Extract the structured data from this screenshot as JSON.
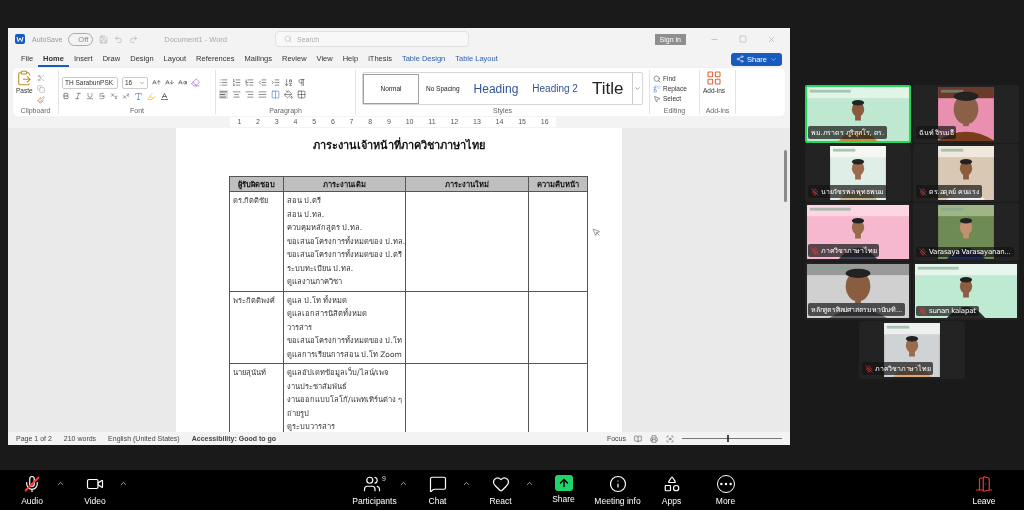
{
  "word": {
    "title_bar": {
      "autosave_label": "AutoSave",
      "autosave_state": "Off",
      "autosave_on": false,
      "document_title": "Document1 - Word",
      "search_placeholder": "Search",
      "sign_in": "Sign in"
    },
    "menu_tabs": [
      {
        "label": "File",
        "selected": false,
        "kind": "normal"
      },
      {
        "label": "Home",
        "selected": true,
        "kind": "normal"
      },
      {
        "label": "Insert",
        "selected": false,
        "kind": "normal"
      },
      {
        "label": "Draw",
        "selected": false,
        "kind": "normal"
      },
      {
        "label": "Design",
        "selected": false,
        "kind": "normal"
      },
      {
        "label": "Layout",
        "selected": false,
        "kind": "normal"
      },
      {
        "label": "References",
        "selected": false,
        "kind": "normal"
      },
      {
        "label": "Mailings",
        "selected": false,
        "kind": "normal"
      },
      {
        "label": "Review",
        "selected": false,
        "kind": "normal"
      },
      {
        "label": "View",
        "selected": false,
        "kind": "normal"
      },
      {
        "label": "Help",
        "selected": false,
        "kind": "normal"
      },
      {
        "label": "iThesis",
        "selected": false,
        "kind": "normal"
      },
      {
        "label": "Table Design",
        "selected": false,
        "kind": "contextual"
      },
      {
        "label": "Table Layout",
        "selected": false,
        "kind": "contextual"
      }
    ],
    "share": "Share",
    "ribbon": {
      "paste": "Paste",
      "font_name": "TH SarabunPSK",
      "font_size": "16",
      "styles": [
        {
          "label": "Normal",
          "kind": "normal",
          "selected": true
        },
        {
          "label": "No Spacing",
          "kind": "nospacing",
          "selected": false
        },
        {
          "label": "Heading",
          "kind": "heading1",
          "selected": false
        },
        {
          "label": "Heading 2",
          "kind": "heading2",
          "selected": false
        },
        {
          "label": "Title",
          "kind": "title",
          "selected": false
        }
      ],
      "editing": [
        "Find",
        "Replace",
        "Select"
      ],
      "addins": "Add-ins",
      "groups": [
        "Clipboard",
        "Font",
        "Paragraph",
        "Styles",
        "Editing",
        "Add-ins"
      ]
    },
    "ruler_numbers": [
      "1",
      "2",
      "3",
      "4",
      "5",
      "6",
      "7",
      "8",
      "9",
      "10",
      "11",
      "12",
      "13",
      "14",
      "15",
      "16"
    ],
    "document": {
      "title": "ภาระงานเจ้าหน้าที่ภาควิชาภาษาไทย",
      "columns": [
        "ผู้รับผิดชอบ",
        "ภาระงานเดิม",
        "ภาระงานใหม่",
        "ความคืบหน้า"
      ],
      "rows": [
        {
          "owner": "ดร.กิตติชัย",
          "tasks": [
            "สอน ป.ตรี",
            "สอน ป.ทล.",
            "ควบคุมหลักสูตร ป.ทล.",
            "ขอเสนอโครงการทั้งหมดของ ป.ทล.",
            "ขอเสนอโครงการทั้งหมดของ ป.ตรี",
            "ระบบทะเบียน ป.ทล.",
            "ดูแลงานภาควิชา"
          ]
        },
        {
          "owner": "พระกิตติพงศ์",
          "tasks": [
            "ดูแล ป.โท ทั้งหมด",
            "ดูแลเอกสารนิสิตทั้งหมด",
            "วารสาร",
            "ขอเสนอโครงการทั้งหมดของ ป.โท",
            "ดูแลการเรียนการสอน ป.โท Zoom"
          ]
        },
        {
          "owner": "นายสุนันท์",
          "tasks": [
            "ดูแลอัปเดทข้อมูลเว็บ/ไลน์/เพจ",
            "งานประชาสัมพันธ์",
            "งานออกแบบโลโก้/แพทเทิร์นต่าง ๆ",
            "ถ่ายรูป",
            "ดูระบบวารสาร"
          ]
        }
      ]
    },
    "status_bar": {
      "page": "Page 1 of 2",
      "words": "210 words",
      "language": "English (United States)",
      "accessibility": "Accessibility: Good to go",
      "focus": "Focus",
      "level": 0.45
    }
  },
  "gallery": [
    {
      "name": "พม.ภราดร ภูริสุสโร, ดร.",
      "muted": false,
      "active": true
    },
    {
      "name": "ฉันท์ จิรเมธี",
      "muted": false,
      "active": false
    },
    {
      "name": "นายวัชรพล พุทธพนม",
      "muted": true,
      "active": false
    },
    {
      "name": "ดร.อดุลย์ คนแรง",
      "muted": true,
      "active": false
    },
    {
      "name": "ภาควิชาภาษาไทย",
      "muted": true,
      "active": false
    },
    {
      "name": "Varasaya Varasayanan...",
      "muted": true,
      "active": false
    },
    {
      "name": "หลักสูตรศิลปศาสตรมหาบัณฑิ...",
      "muted": false,
      "active": false
    },
    {
      "name": "sunan kalapat",
      "muted": true,
      "active": false
    },
    {
      "name": "ภาควิชาภาษาไทย",
      "muted": true,
      "active": false
    }
  ],
  "toolbar": [
    {
      "label": "Audio",
      "kind": "audio",
      "muted": true,
      "menu": true
    },
    {
      "label": "Video",
      "kind": "video",
      "menu": true
    },
    {
      "label": "Participants",
      "kind": "participants",
      "count": "9",
      "menu": true
    },
    {
      "label": "Chat",
      "kind": "chat",
      "menu": true
    },
    {
      "label": "React",
      "kind": "react",
      "menu": true
    },
    {
      "label": "Share",
      "kind": "share",
      "menu": false
    },
    {
      "label": "Meeting info",
      "kind": "info",
      "menu": false
    },
    {
      "label": "Apps",
      "kind": "apps",
      "menu": false
    },
    {
      "label": "More",
      "kind": "more",
      "menu": false
    },
    {
      "label": "Leave",
      "kind": "leave",
      "menu": false
    }
  ]
}
